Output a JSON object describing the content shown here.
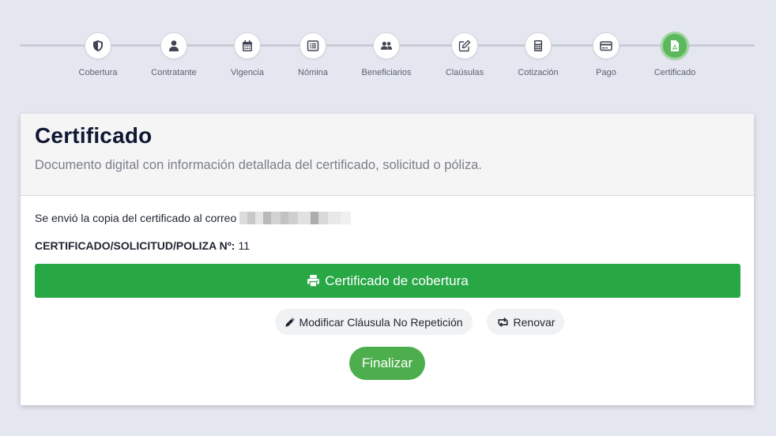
{
  "stepper": {
    "steps": [
      {
        "label": "Cobertura",
        "icon": "shield-icon"
      },
      {
        "label": "Contratante",
        "icon": "user-icon"
      },
      {
        "label": "Vigencia",
        "icon": "calendar-icon"
      },
      {
        "label": "Nómina",
        "icon": "list-icon"
      },
      {
        "label": "Beneficiarios",
        "icon": "users-icon"
      },
      {
        "label": "Claúsulas",
        "icon": "edit-icon"
      },
      {
        "label": "Cotización",
        "icon": "calculator-icon"
      },
      {
        "label": "Pago",
        "icon": "credit-card-icon"
      },
      {
        "label": "Certificado",
        "icon": "pdf-file-icon",
        "active": true
      }
    ],
    "active_color": "#5cb85c"
  },
  "card": {
    "title": "Certificado",
    "subtitle": "Documento digital con información detallada del certificado, solicitud o póliza.",
    "sent_text": "Se envió la copia del certificado al correo",
    "policy_label": "CERTIFICADO/SOLICITUD/POLIZA Nº:",
    "policy_number": "11",
    "certificate_button": "Certificado de cobertura",
    "modify_button": "Modificar Cláusula No Repetición",
    "renew_button": "Renovar",
    "finish_button": "Finalizar"
  },
  "colors": {
    "primary_green": "#28a745",
    "finish_green": "#4cae4c",
    "background": "#e5e7f0"
  }
}
